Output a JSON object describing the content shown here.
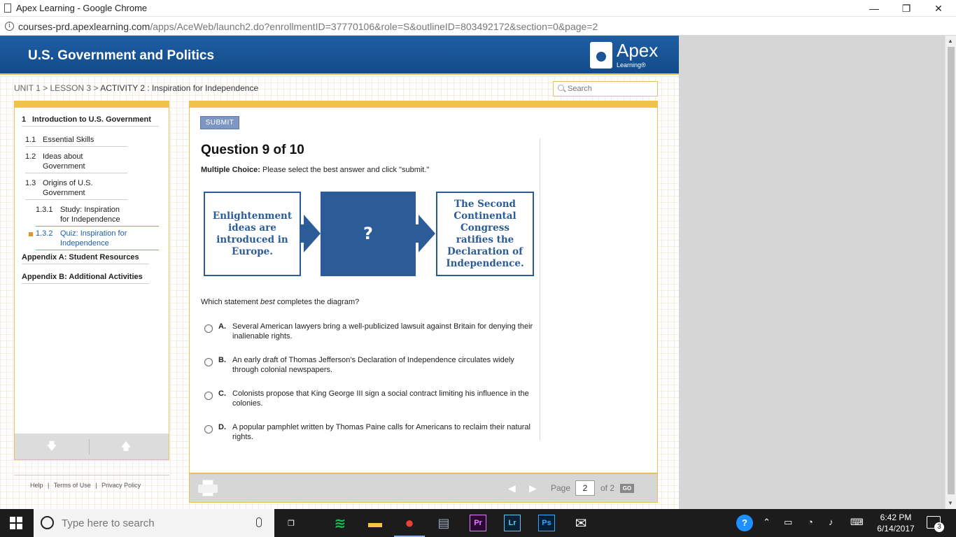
{
  "window": {
    "title": "Apex Learning - Google Chrome",
    "minimize_glyph": "—",
    "restore_glyph": "❐",
    "close_glyph": "✕"
  },
  "address_bar": {
    "url_host": "courses-prd.apexlearning.com",
    "url_path": "/apps/AceWeb/launch2.do?enrollmentID=37770106&role=S&outlineID=803492172&section=0&page=2",
    "info_icon": "info-icon"
  },
  "course": {
    "title": "U.S. Government and Politics",
    "logo_brand": "Apex",
    "logo_sub": "Learning®"
  },
  "breadcrumb": {
    "unit": "UNIT 1",
    "lesson": "LESSON 3",
    "sep": " > ",
    "activity": "ACTIVITY 2 : Inspiration for Independence"
  },
  "search": {
    "placeholder": "Search"
  },
  "nav": {
    "section": {
      "num": "1",
      "label": "Introduction to U.S. Government"
    },
    "items": [
      {
        "num": "1.1",
        "label": "Essential Skills"
      },
      {
        "num": "1.2",
        "label": "Ideas about Government"
      },
      {
        "num": "1.3",
        "label": "Origins of U.S. Government"
      },
      {
        "num": "1.3.1",
        "label": "Study: Inspiration for Independence"
      },
      {
        "num": "1.3.2",
        "label": "Quiz: Inspiration for Independence"
      }
    ],
    "appendix_a": "Appendix A: Student Resources",
    "appendix_b": "Appendix B: Additional Activities",
    "down_glyph": "🡇",
    "up_glyph": "🡅"
  },
  "footer": {
    "help": "Help",
    "terms": "Terms of Use",
    "privacy": "Privacy Policy",
    "sep": "|"
  },
  "question": {
    "submit_label": "SUBMIT",
    "title": "Question 9 of 10",
    "instruction_bold": "Multiple Choice:",
    "instruction_text": " Please select the best answer and click \"submit.\"",
    "diagram": {
      "left": "Enlightenment ideas are introduced in Europe.",
      "middle": "?",
      "right": "The Second Continental Congress ratifies the Declaration of Independence."
    },
    "stem_pre": "Which statement ",
    "stem_em": "best",
    "stem_post": " completes the diagram?",
    "choices": [
      {
        "letter": "A.",
        "text": "Several American lawyers bring a well-publicized lawsuit against Britain for denying their inalienable rights."
      },
      {
        "letter": "B.",
        "text": "An early draft of Thomas Jefferson's Declaration of Independence circulates widely through colonial newspapers."
      },
      {
        "letter": "C.",
        "text": "Colonists propose that King George III sign a social contract limiting his influence in the colonies."
      },
      {
        "letter": "D.",
        "text": "A popular pamphlet written by Thomas Paine calls for Americans to reclaim their natural rights."
      }
    ]
  },
  "pager": {
    "page_label": "Page",
    "current_page": "2",
    "of_label": "of 2",
    "go_label": "GO",
    "prev_glyph": "◀",
    "next_glyph": "▶"
  },
  "taskbar": {
    "search_placeholder": "Type here to search",
    "apps": [
      {
        "name": "task-view-icon",
        "glyph": "❐"
      },
      {
        "name": "spotify-icon",
        "glyph": "≋",
        "color": "#1db954"
      },
      {
        "name": "file-explorer-icon",
        "glyph": "▬",
        "color": "#f6c343"
      },
      {
        "name": "chrome-icon",
        "glyph": "●",
        "color": "#e94235"
      },
      {
        "name": "control-panel-icon",
        "glyph": "▤",
        "color": "#9ab"
      },
      {
        "name": "premiere-icon",
        "glyph": "Pr",
        "color": "#e77cff"
      },
      {
        "name": "lightroom-icon",
        "glyph": "Lr",
        "color": "#5ec5f5"
      },
      {
        "name": "photoshop-icon",
        "glyph": "Ps",
        "color": "#31a8ff"
      },
      {
        "name": "mail-icon",
        "glyph": "✉",
        "color": "#ffffff"
      }
    ],
    "time": "6:42 PM",
    "date": "6/14/2017",
    "notification_count": "3"
  }
}
